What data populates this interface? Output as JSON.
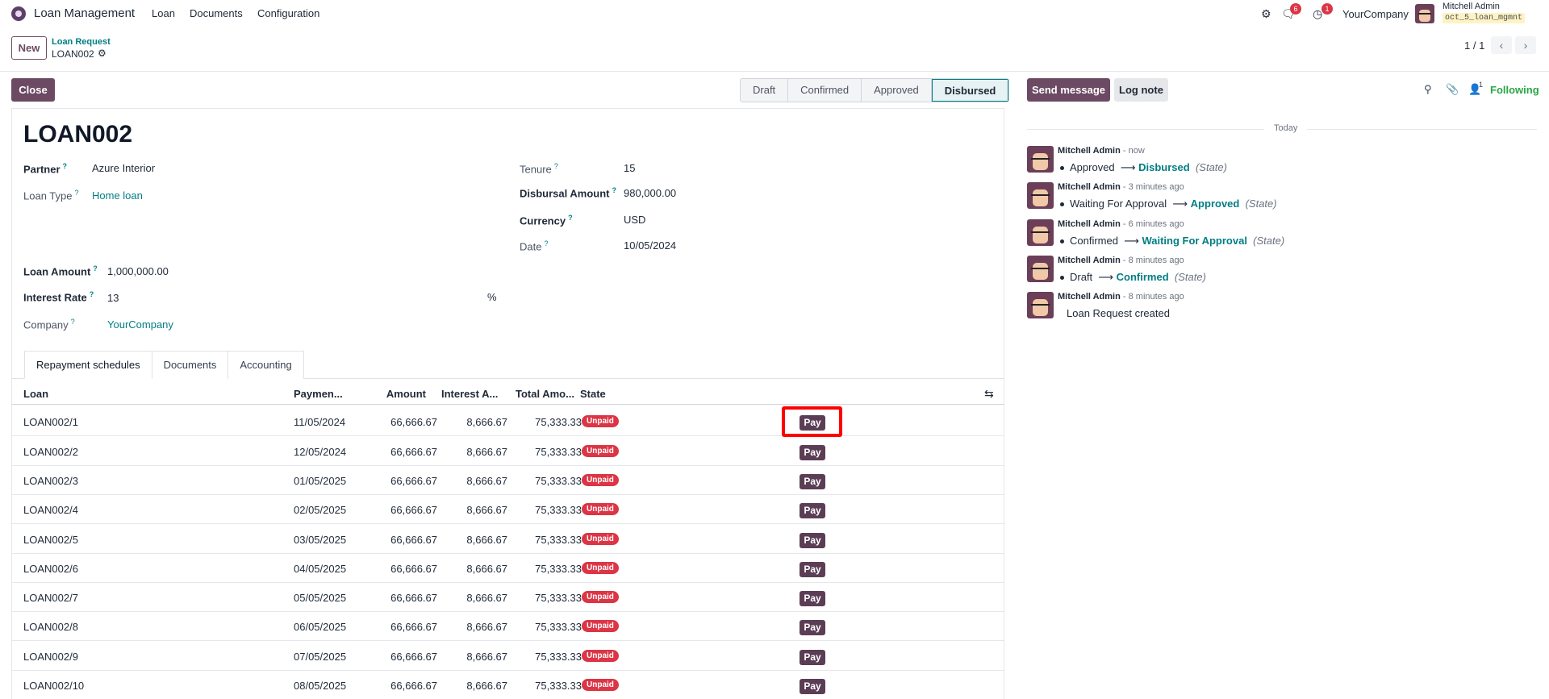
{
  "nav": {
    "app_name": "Loan Management",
    "menus": [
      "Loan",
      "Documents",
      "Configuration"
    ],
    "chat_count": "6",
    "activity_count": "1",
    "company": "YourCompany",
    "user_name": "Mitchell Admin",
    "database": "oct_5_loan_mgmnt"
  },
  "control": {
    "new_label": "New",
    "breadcrumb_parent": "Loan Request",
    "breadcrumb_current": "LOAN002",
    "pager": "1 / 1"
  },
  "statusbar": {
    "close_label": "Close",
    "stages": [
      "Draft",
      "Confirmed",
      "Approved",
      "Disbursed"
    ],
    "active_stage": "Disbursed"
  },
  "form": {
    "title": "LOAN002",
    "partner_label": "Partner",
    "partner": "Azure Interior",
    "loan_type_label": "Loan Type",
    "loan_type": "Home loan",
    "loan_amount_label": "Loan Amount",
    "loan_amount": "1,000,000.00",
    "interest_rate_label": "Interest Rate",
    "interest_rate": "13",
    "interest_unit": "%",
    "company_label": "Company",
    "company": "YourCompany",
    "tenure_label": "Tenure",
    "tenure": "15",
    "disbursal_label": "Disbursal Amount",
    "disbursal": "980,000.00",
    "currency_label": "Currency",
    "currency": "USD",
    "date_label": "Date",
    "date": "10/05/2024",
    "help_mark": "?"
  },
  "tabs": [
    "Repayment schedules",
    "Documents",
    "Accounting"
  ],
  "table": {
    "columns": [
      "Loan",
      "Paymen...",
      "Amount",
      "Interest A...",
      "Total Amo...",
      "State"
    ],
    "state_label": "Unpaid",
    "pay_label": "Pay",
    "rows": [
      {
        "loan": "LOAN002/1",
        "date": "11/05/2024",
        "amount": "66,666.67",
        "interest": "8,666.67",
        "total": "75,333.33"
      },
      {
        "loan": "LOAN002/2",
        "date": "12/05/2024",
        "amount": "66,666.67",
        "interest": "8,666.67",
        "total": "75,333.33"
      },
      {
        "loan": "LOAN002/3",
        "date": "01/05/2025",
        "amount": "66,666.67",
        "interest": "8,666.67",
        "total": "75,333.33"
      },
      {
        "loan": "LOAN002/4",
        "date": "02/05/2025",
        "amount": "66,666.67",
        "interest": "8,666.67",
        "total": "75,333.33"
      },
      {
        "loan": "LOAN002/5",
        "date": "03/05/2025",
        "amount": "66,666.67",
        "interest": "8,666.67",
        "total": "75,333.33"
      },
      {
        "loan": "LOAN002/6",
        "date": "04/05/2025",
        "amount": "66,666.67",
        "interest": "8,666.67",
        "total": "75,333.33"
      },
      {
        "loan": "LOAN002/7",
        "date": "05/05/2025",
        "amount": "66,666.67",
        "interest": "8,666.67",
        "total": "75,333.33"
      },
      {
        "loan": "LOAN002/8",
        "date": "06/05/2025",
        "amount": "66,666.67",
        "interest": "8,666.67",
        "total": "75,333.33"
      },
      {
        "loan": "LOAN002/9",
        "date": "07/05/2025",
        "amount": "66,666.67",
        "interest": "8,666.67",
        "total": "75,333.33"
      },
      {
        "loan": "LOAN002/10",
        "date": "08/05/2025",
        "amount": "66,666.67",
        "interest": "8,666.67",
        "total": "75,333.33"
      }
    ]
  },
  "chatter": {
    "send_label": "Send message",
    "log_label": "Log note",
    "follower_count": "1",
    "following_label": "Following",
    "day_label": "Today",
    "messages": [
      {
        "author": "Mitchell Admin",
        "time": "- now",
        "old": "Approved",
        "new": "Disbursed",
        "field": "(State)"
      },
      {
        "author": "Mitchell Admin",
        "time": "- 3 minutes ago",
        "old": "Waiting For Approval",
        "new": "Approved",
        "field": "(State)"
      },
      {
        "author": "Mitchell Admin",
        "time": "- 6 minutes ago",
        "old": "Confirmed",
        "new": "Waiting For Approval",
        "field": "(State)"
      },
      {
        "author": "Mitchell Admin",
        "time": "- 8 minutes ago",
        "old": "Draft",
        "new": "Confirmed",
        "field": "(State)"
      },
      {
        "author": "Mitchell Admin",
        "time": "- 8 minutes ago",
        "body": "Loan Request created"
      }
    ]
  }
}
